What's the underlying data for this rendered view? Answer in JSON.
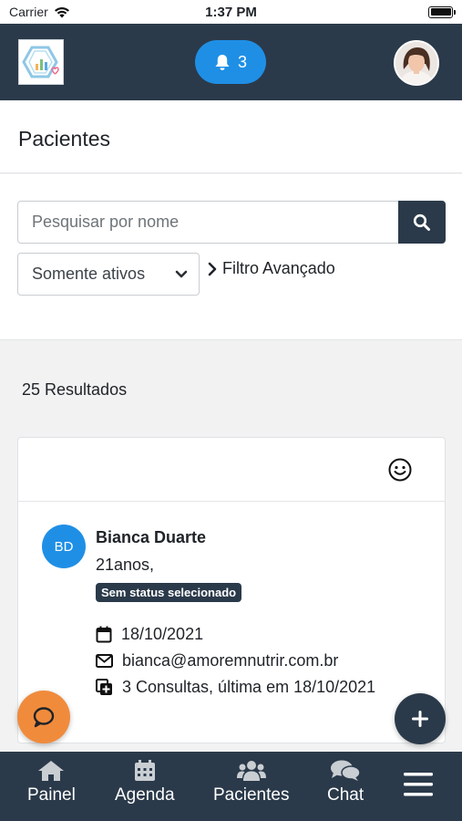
{
  "status_bar": {
    "carrier": "Carrier",
    "time": "1:37 PM"
  },
  "header": {
    "notification_count": "3"
  },
  "page": {
    "title": "Pacientes"
  },
  "filters": {
    "search_placeholder": "Pesquisar por nome",
    "status_select": "Somente ativos",
    "advanced_filter": "Filtro Avançado"
  },
  "results": {
    "count_label": "25 Resultados"
  },
  "patients": [
    {
      "initials": "BD",
      "name": "Bianca Duarte",
      "age": "21anos,",
      "status": "Sem status selecionado",
      "date": "18/10/2021",
      "email": "bianca@amoremnutrir.com.br",
      "consultations": "3 Consultas, última em 18/10/2021"
    }
  ],
  "bottom_nav": {
    "items": [
      {
        "label": "Painel",
        "icon": "home-icon"
      },
      {
        "label": "Agenda",
        "icon": "calendar-icon"
      },
      {
        "label": "Pacientes",
        "icon": "users-icon"
      },
      {
        "label": "Chat",
        "icon": "chat-icon"
      },
      {
        "label": "",
        "icon": "menu-icon"
      }
    ]
  },
  "colors": {
    "primary_dark": "#2b3a4a",
    "accent_blue": "#1f8fe6",
    "accent_orange": "#f08b3c"
  }
}
